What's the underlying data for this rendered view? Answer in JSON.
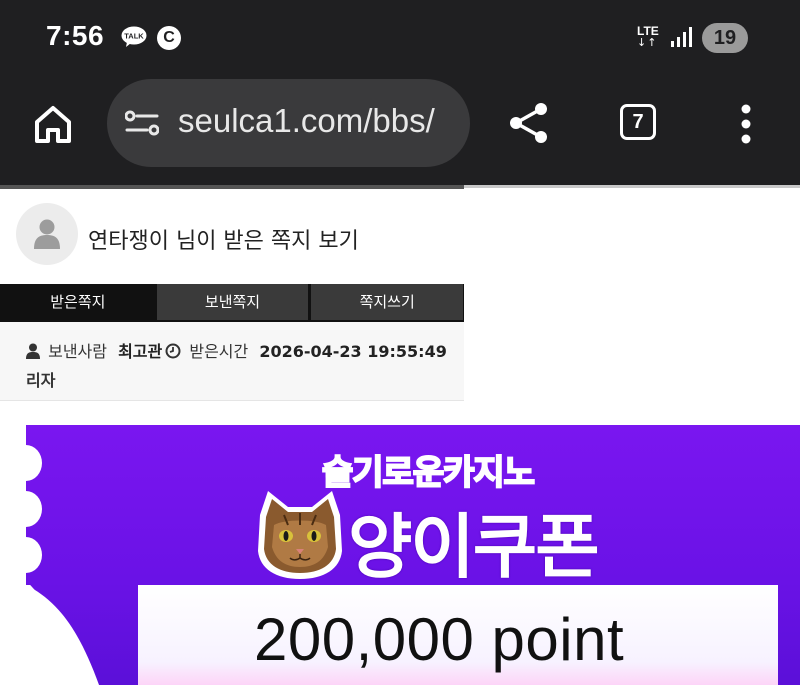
{
  "status_bar": {
    "time": "7:56",
    "talk_icon": "kakaotalk-icon",
    "c_icon_label": "C",
    "network": "LTE",
    "battery": "19"
  },
  "browser": {
    "url": "seulca1.com/bbs/",
    "tab_count": "7",
    "icons": [
      "home-icon",
      "site-settings-icon",
      "share-icon",
      "tabs-icon",
      "more-vert-icon"
    ]
  },
  "message_page": {
    "title": "연타쟁이 님이 받은 쪽지 보기",
    "tabs": [
      {
        "label": "받은쪽지",
        "active": true
      },
      {
        "label": "보낸쪽지",
        "active": false
      },
      {
        "label": "쪽지쓰기",
        "active": false
      }
    ],
    "sender_label": "보낸사람",
    "sender_name": "최고관",
    "received_label": "받은시간",
    "received_time": "2026-04-23 19:55:49",
    "sender_name_cont": "리자"
  },
  "banner": {
    "subtitle": "슬기로운카지노",
    "title": "양이쿠폰",
    "amount": "200,000 point",
    "colors": {
      "background": "#6a12e6",
      "subtitle": "#ff2222",
      "title": "#ffffff"
    }
  }
}
